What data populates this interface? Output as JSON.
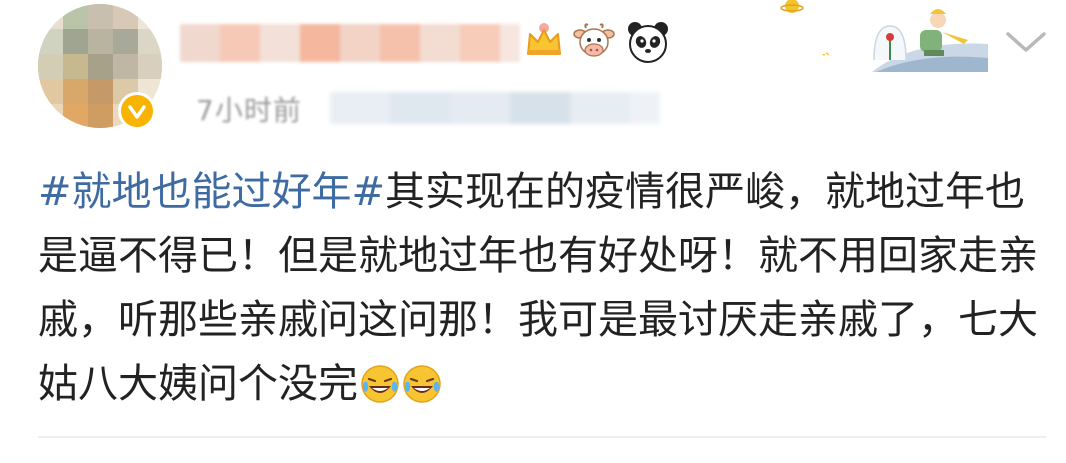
{
  "post": {
    "time": "7小时前",
    "topic": "#就地也能过好年#",
    "body_text": "其实现在的疫情很严峻，就地过年也是逼不得已！但是就地过年也有好处呀！就不用回家走亲戚，听那些亲戚问这问那！我可是最讨厌走亲戚了，七大姑八大姨问个没完",
    "emojis": [
      "laugh-cry-icon",
      "laugh-cry-icon"
    ]
  },
  "header": {
    "badges": [
      "crown-icon",
      "cow-icon",
      "panda-icon"
    ],
    "verified_color": "#f8b400",
    "menu_icon": "chevron-down-icon"
  },
  "colors": {
    "topic": "#3f6ba3",
    "text": "#222222",
    "meta": "#9a9a9a"
  }
}
